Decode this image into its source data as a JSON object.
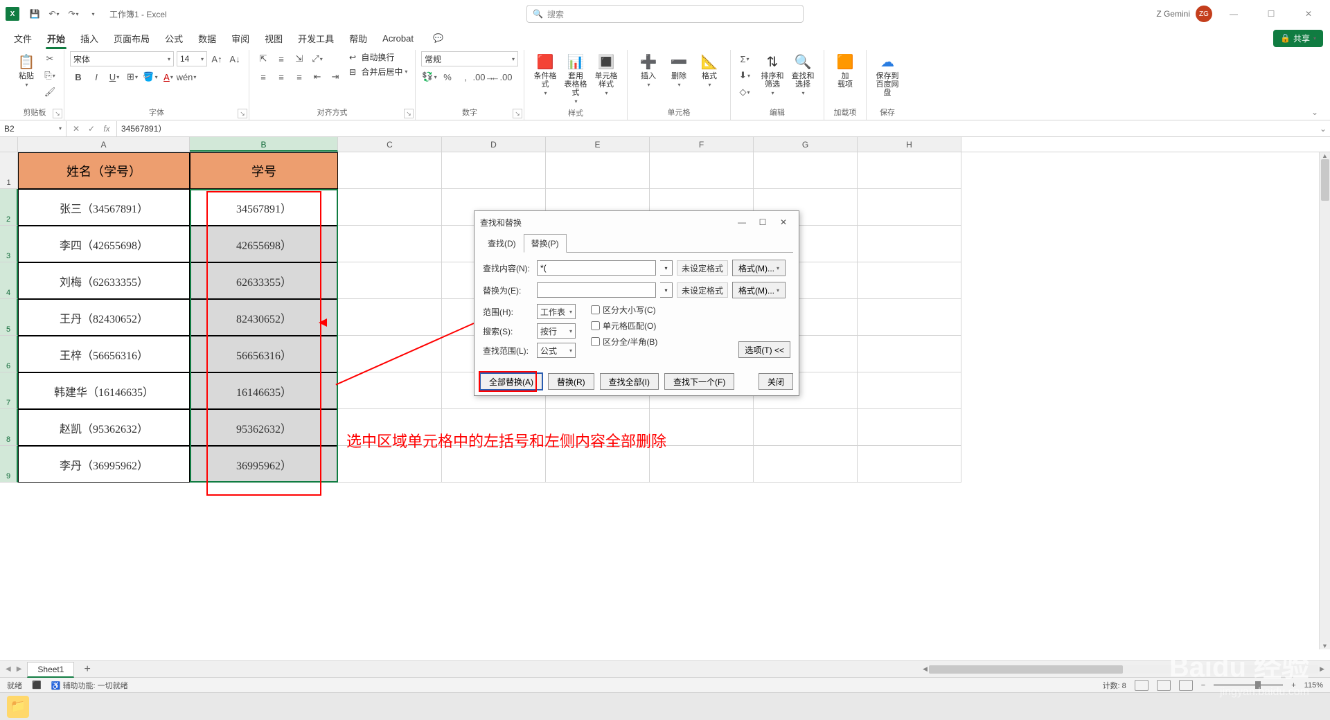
{
  "titlebar": {
    "app_icon": "X",
    "title": "工作簿1 - Excel",
    "search_placeholder": "搜索",
    "user_name": "Z Gemini",
    "user_initials": "ZG"
  },
  "tabs": {
    "items": [
      "文件",
      "开始",
      "插入",
      "页面布局",
      "公式",
      "数据",
      "审阅",
      "视图",
      "开发工具",
      "帮助",
      "Acrobat"
    ],
    "active_index": 1,
    "share": "共享"
  },
  "ribbon": {
    "clipboard": {
      "paste": "粘贴",
      "label": "剪贴板"
    },
    "font": {
      "name": "宋体",
      "size": "14",
      "label": "字体"
    },
    "alignment": {
      "wrap": "自动换行",
      "merge": "合并后居中",
      "label": "对齐方式"
    },
    "number": {
      "format": "常规",
      "label": "数字"
    },
    "styles": {
      "cond": "条件格式",
      "table": "套用\n表格格式",
      "cell": "单元格样式",
      "label": "样式"
    },
    "cells": {
      "insert": "插入",
      "delete": "删除",
      "format": "格式",
      "label": "单元格"
    },
    "editing": {
      "sort": "排序和筛选",
      "find": "查找和选择",
      "label": "编辑"
    },
    "addins": {
      "load": "加\n载项",
      "label": "加载项"
    },
    "save": {
      "baidu": "保存到\n百度网盘",
      "label": "保存"
    }
  },
  "formulabar": {
    "namebox": "B2",
    "formula": "34567891）"
  },
  "grid": {
    "columns": [
      "A",
      "B",
      "C",
      "D",
      "E",
      "F",
      "G",
      "H"
    ],
    "row_nums": [
      "1",
      "2",
      "3",
      "4",
      "5",
      "6",
      "7",
      "8",
      "9"
    ],
    "header": {
      "A": "姓名（学号）",
      "B": "学号"
    },
    "rows": [
      {
        "A": "张三（34567891）",
        "B": "34567891）"
      },
      {
        "A": "李四（42655698）",
        "B": "42655698）"
      },
      {
        "A": "刘梅（62633355）",
        "B": "62633355）"
      },
      {
        "A": "王丹（82430652）",
        "B": "82430652）"
      },
      {
        "A": "王梓（56656316）",
        "B": "56656316）"
      },
      {
        "A": "韩建华（16146635）",
        "B": "16146635）"
      },
      {
        "A": "赵凯（95362632）",
        "B": "95362632）"
      },
      {
        "A": "李丹（36995962）",
        "B": "36995962）"
      }
    ]
  },
  "dialog": {
    "title": "查找和替换",
    "tabs": {
      "find": "查找(D)",
      "replace": "替换(P)"
    },
    "find_label": "查找内容(N):",
    "find_value": "*(",
    "replace_label": "替换为(E):",
    "replace_value": "",
    "no_format": "未设定格式",
    "format_btn": "格式(M)...",
    "scope_label": "范围(H):",
    "scope_value": "工作表",
    "search_label": "搜索(S):",
    "search_value": "按行",
    "lookin_label": "查找范围(L):",
    "lookin_value": "公式",
    "match_case": "区分大小写(C)",
    "match_cell": "单元格匹配(O)",
    "match_width": "区分全/半角(B)",
    "options": "选项(T) <<",
    "replace_all": "全部替换(A)",
    "replace_btn": "替换(R)",
    "find_all": "查找全部(I)",
    "find_next": "查找下一个(F)",
    "close": "关闭"
  },
  "annotation": "选中区域单元格中的左括号和左侧内容全部删除",
  "sheettabs": {
    "sheet1": "Sheet1"
  },
  "statusbar": {
    "ready": "就绪",
    "accessibility": "辅助功能: 一切就绪",
    "count": "计数: 8",
    "zoom": "115%"
  },
  "watermark": {
    "main": "Baidu 经验",
    "sub": "jingyan.baidu.com"
  }
}
